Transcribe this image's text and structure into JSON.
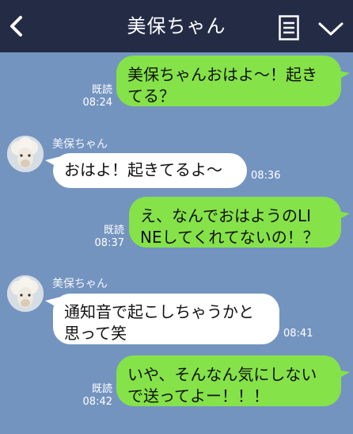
{
  "header": {
    "title": "美保ちゃん",
    "back_icon": "chevron-left-icon",
    "menu_icon": "document-list-icon",
    "more_icon": "chevron-down-icon"
  },
  "colors": {
    "background": "#7494c0",
    "header": "#242c45",
    "sent_bubble": "#85e249",
    "received_bubble": "#ffffff"
  },
  "messages": [
    {
      "side": "sent",
      "lines": [
        "美保ちゃんおはよ～！起き",
        "てる？"
      ],
      "read": "既読",
      "time": "08:24"
    },
    {
      "side": "received",
      "sender": "美保ちゃん",
      "lines": [
        "おはよ！起きてるよ～"
      ],
      "time": "08:36"
    },
    {
      "side": "sent",
      "lines": [
        "え、なんでおはようのLI",
        "NEしてくれてないの！？"
      ],
      "read": "既読",
      "time": "08:37"
    },
    {
      "side": "received",
      "sender": "美保ちゃん",
      "lines": [
        "通知音で起こしちゃうかと",
        "思って笑"
      ],
      "time": "08:41"
    },
    {
      "side": "sent",
      "lines": [
        "いや、そんなん気にしない",
        "で送ってよー！！！"
      ],
      "read": "既読",
      "time": "08:42"
    }
  ]
}
